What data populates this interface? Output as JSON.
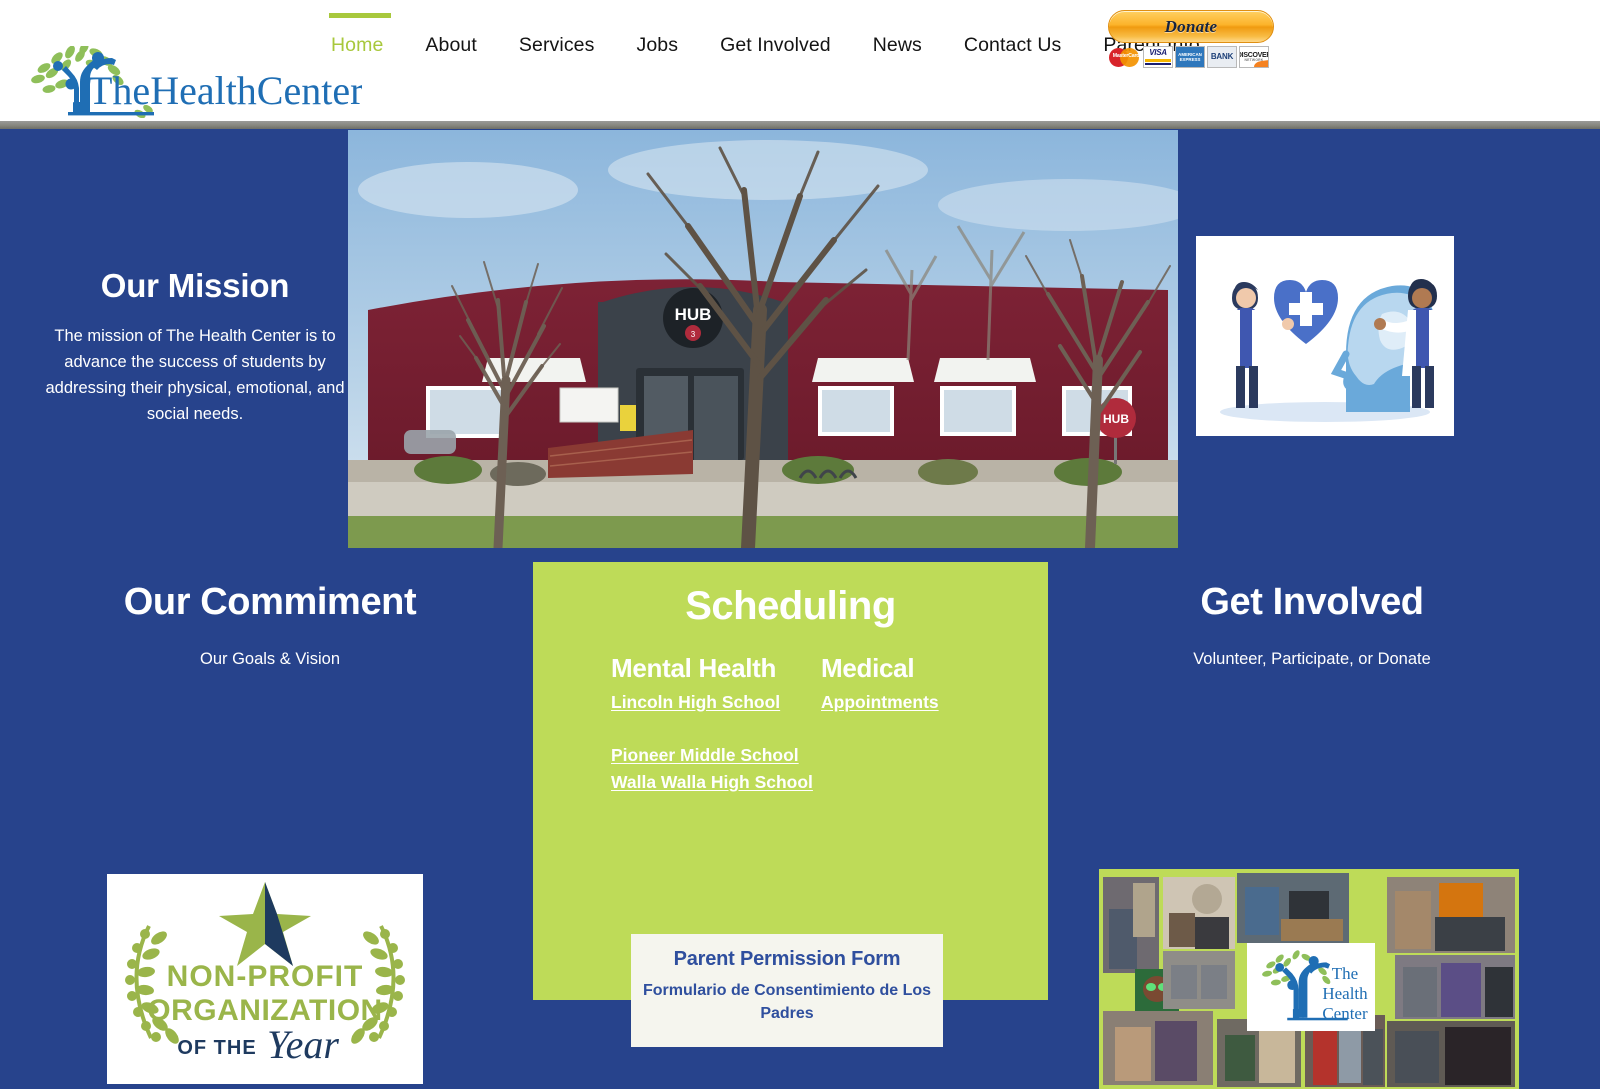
{
  "header": {
    "logo": {
      "text": "TheHealthCenter",
      "icon": "tree-people-logo",
      "color": "#1f6eb4",
      "leaf_color": "#8fbf5a"
    },
    "nav": [
      {
        "label": "Home",
        "active": true
      },
      {
        "label": "About",
        "active": false
      },
      {
        "label": "Services",
        "active": false
      },
      {
        "label": "Jobs",
        "active": false
      },
      {
        "label": "Get Involved",
        "active": false
      },
      {
        "label": "News",
        "active": false
      },
      {
        "label": "Contact Us",
        "active": false
      },
      {
        "label": "Parent Info",
        "active": false
      }
    ],
    "active_color": "#a8c83c",
    "donate": {
      "label": "Donate",
      "cards": [
        {
          "name": "mastercard-icon",
          "label": "MasterCard"
        },
        {
          "name": "visa-icon",
          "label": "VISA"
        },
        {
          "name": "amex-icon",
          "label": "AMERICAN EXPRESS"
        },
        {
          "name": "bank-icon",
          "label": "BANK"
        },
        {
          "name": "discover-icon",
          "label": "DISCOVER",
          "sub": "NETWORK"
        }
      ]
    }
  },
  "mission": {
    "heading": "Our Mission",
    "body": "The mission of The Health Center is to advance the success of students by addressing their physical, emotional, and social needs."
  },
  "hero": {
    "building_photo_alt": "The HUB on 3rd building exterior with bare trees",
    "illustration_alt": "Two doctors holding a heart with cross and a head with brain illustration"
  },
  "commitment": {
    "heading": "Our Commiment",
    "subheading": "Our Goals & Vision",
    "award": {
      "line1": "NON-PROFIT",
      "line2": "ORGANIZATION",
      "line3": "OF THE",
      "line4": "Year",
      "green": "#9ab54a",
      "navy": "#1e3a5f"
    }
  },
  "scheduling": {
    "heading": "Scheduling",
    "panel_color": "#bedb58",
    "mental_health": {
      "heading": "Mental Health",
      "links": [
        "Lincoln High School",
        "Pioneer Middle School",
        "Walla Walla High School"
      ]
    },
    "medical": {
      "heading": "Medical",
      "links": [
        "Appointments"
      ]
    },
    "permission_form": {
      "title": "Parent Permission Form",
      "subtitle": "Formulario de Consentimiento de Los Padres",
      "text_color": "#2f4f9e"
    }
  },
  "get_involved": {
    "heading": "Get Involved",
    "subheading": "Volunteer, Participate, or Donate",
    "collage_alt": "Photo collage of staff and students with The Health Center logo",
    "collage_logo_text": [
      "The",
      "Health",
      "Center"
    ]
  },
  "theme": {
    "page_background": "#27438c",
    "accent_green": "#a8c83c",
    "panel_green": "#bedb58",
    "white": "#ffffff"
  }
}
